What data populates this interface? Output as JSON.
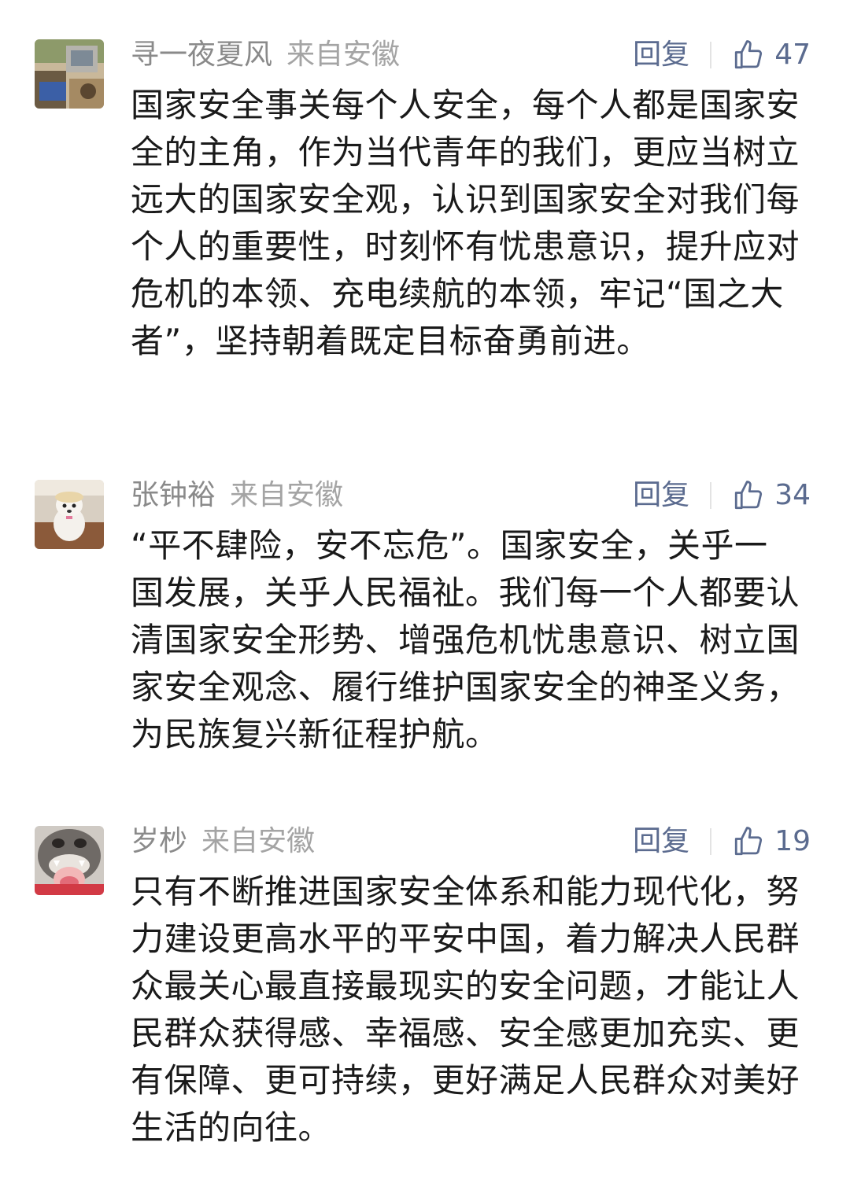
{
  "comments": [
    {
      "nickname": "寻一夜夏风",
      "origin": "来自安徽",
      "reply_label": "回复",
      "likes": "47",
      "avatar_icon": "photo-avatar-icon",
      "text": "国家安全事关每个人安全，每个人都是国家安全的主角，作为当代青年的我们，更应当树立远大的国家安全观，认识到国家安全对我们每个人的重要性，时刻怀有忧患意识，提升应对危机的本领、充电续航的本领，牢记“国之大者”，坚持朝着既定目标奋勇前进。"
    },
    {
      "nickname": "张钟裕",
      "origin": "来自安徽",
      "reply_label": "回复",
      "likes": "34",
      "avatar_icon": "dog-avatar-icon",
      "text": "“平不肆险，安不忘危”。国家安全，关乎一国发展，关乎人民福祉。我们每一个人都要认清国家安全形势、增强危机忧患意识、树立国家安全观念、履行维护国家安全的神圣义务，为民族复兴新征程护航。"
    },
    {
      "nickname": "岁杪",
      "origin": "来自安徽",
      "reply_label": "回复",
      "likes": "19",
      "avatar_icon": "costume-avatar-icon",
      "text": "只有不断推进国家安全体系和能力现代化，努力建设更高水平的平安中国，着力解决人民群众最关心最直接最现实的安全问题，才能让人民群众获得感、幸福感、安全感更加充实、更有保障、更可持续，更好满足人民群众对美好生活的向往。"
    }
  ],
  "colors": {
    "nickname": "#8a8a8a",
    "origin": "#a4a4a4",
    "link_blue": "#5b6b8f",
    "body_text": "#1a1a1a",
    "background": "#ffffff"
  }
}
